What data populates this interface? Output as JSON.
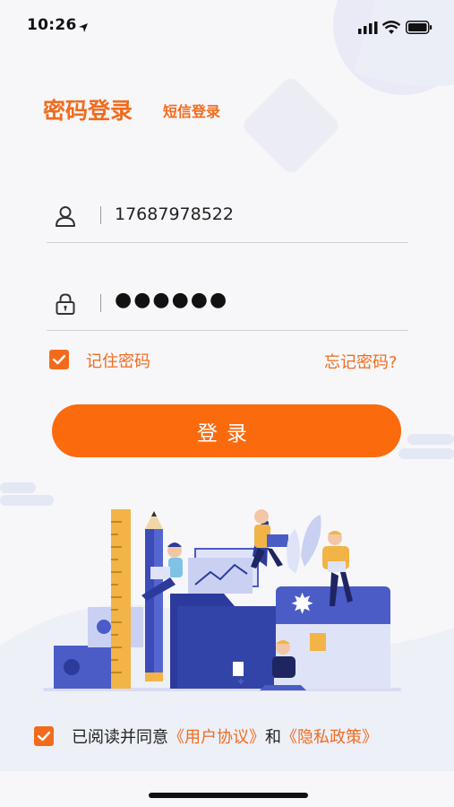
{
  "status_bar": {
    "time": "10:26"
  },
  "tabs": {
    "password_login": "密码登录",
    "sms_login": "短信登录"
  },
  "form": {
    "phone_value": "17687978522",
    "password_value": "●●●●●●",
    "remember_label": "记住密码",
    "remember_checked": true,
    "forgot_label": "忘记密码?",
    "login_label": "登录"
  },
  "agreement": {
    "prefix": "已阅读并同意",
    "user_agreement": "《用户协议》",
    "conjunction": "和",
    "privacy_policy": "《隐私政策》",
    "checked": true
  },
  "colors": {
    "accent": "#f26b1d",
    "button": "#fb6a0c",
    "illustration_blue": "#4b5cc7"
  }
}
